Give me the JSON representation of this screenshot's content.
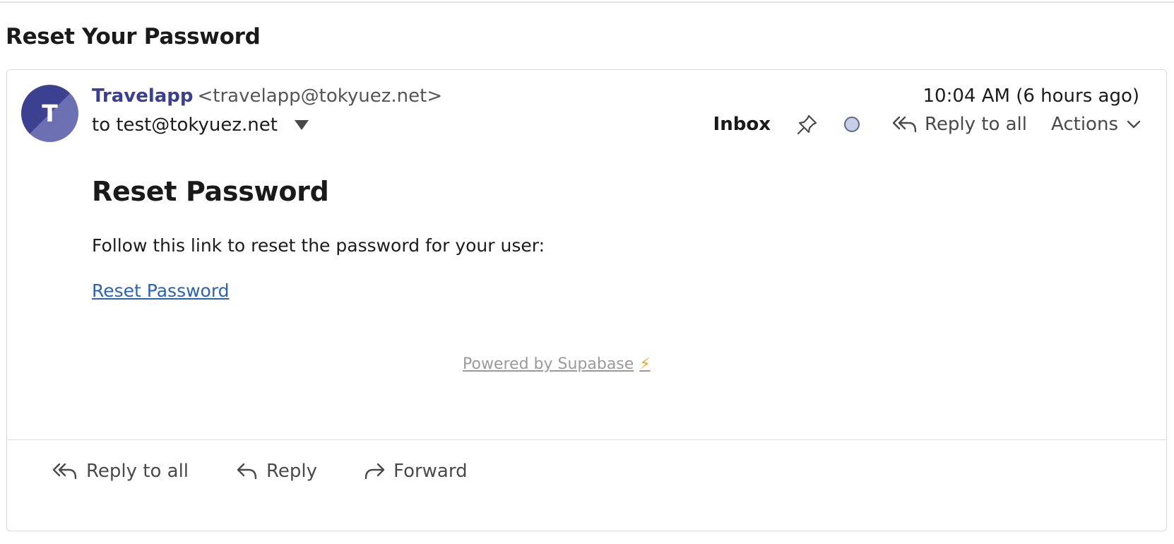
{
  "message": {
    "subject": "Reset Your Password",
    "avatar_letter": "T",
    "sender_name": "Travelapp",
    "sender_email": "<travelapp@tokyuez.net>",
    "to_line": "to test@tokyuez.net",
    "timestamp": "10:04 AM (6 hours ago)",
    "folder": "Inbox"
  },
  "toolbar": {
    "reply_all_label": "Reply to all",
    "actions_label": "Actions",
    "icons": [
      "pin-icon",
      "unread-dot-icon",
      "reply-all-icon",
      "chevron-down-icon"
    ]
  },
  "body": {
    "heading": "Reset Password",
    "text": "Follow this link to reset the password for your user:",
    "link_label": "Reset Password",
    "powered_by": "Powered by Supabase",
    "bolt": "⚡"
  },
  "footer": {
    "reply_all_label": "Reply to all",
    "reply_label": "Reply",
    "forward_label": "Forward"
  },
  "colors": {
    "sender_accent": "#3b3f93",
    "link": "#2b63b8",
    "bolt": "#f2a21a",
    "unread_dot": "#c7cfe8"
  }
}
